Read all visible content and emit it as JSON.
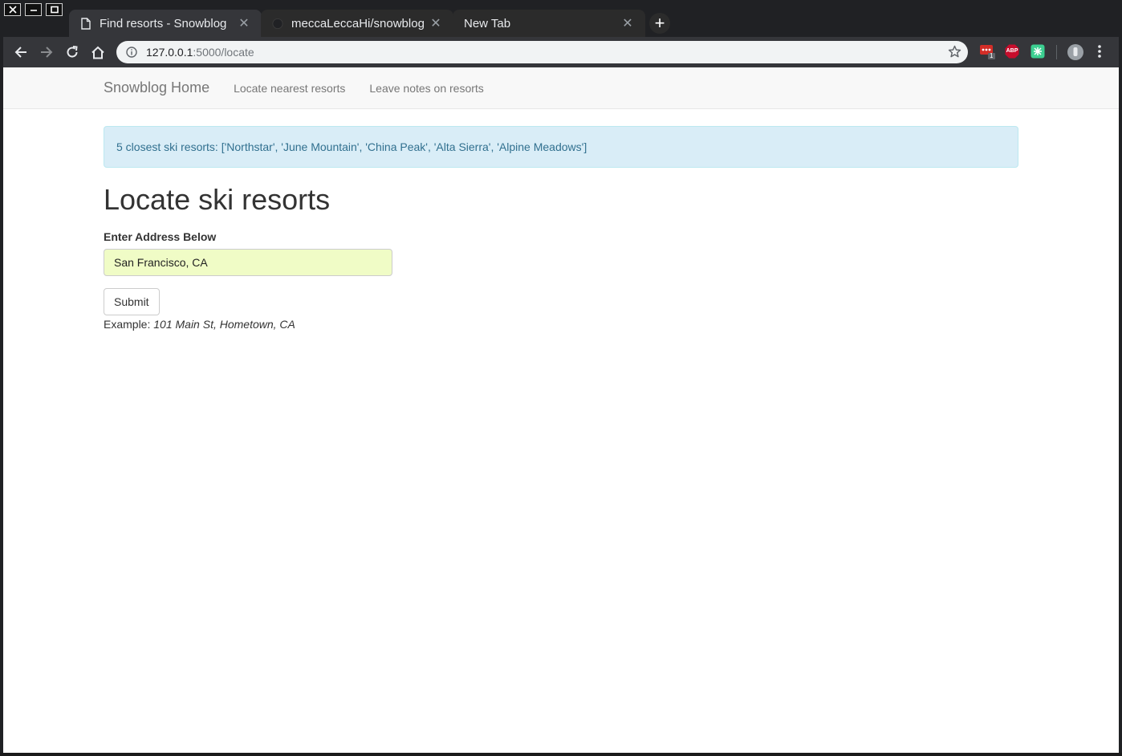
{
  "browser": {
    "tabs": [
      {
        "title": "Find resorts - Snowblog",
        "active": true,
        "icon": "page-icon"
      },
      {
        "title": "meccaLeccaHi/snowblog: ",
        "active": false,
        "icon": "github-icon"
      },
      {
        "title": "New Tab",
        "active": false,
        "icon": ""
      }
    ],
    "new_tab_label": "+",
    "url_host": "127.0.0.1",
    "url_path": ":5000/locate",
    "extension_badge": "1",
    "abp_label": "ABP"
  },
  "navbar": {
    "brand": "Snowblog Home",
    "links": [
      "Locate nearest resorts",
      "Leave notes on resorts"
    ]
  },
  "alert": {
    "text": "5 closest ski resorts: ['Northstar', 'June Mountain', 'China Peak', 'Alta Sierra', 'Alpine Meadows']"
  },
  "main": {
    "heading": "Locate ski resorts",
    "field_label": "Enter Address Below",
    "address_value": "San Francisco, CA",
    "submit_label": "Submit",
    "example_prefix": "Example: ",
    "example_value": "101 Main St, Hometown, CA"
  },
  "colors": {
    "alert_bg": "#d9edf7",
    "alert_text": "#31708f",
    "input_autofill_bg": "#f0fcc6"
  }
}
